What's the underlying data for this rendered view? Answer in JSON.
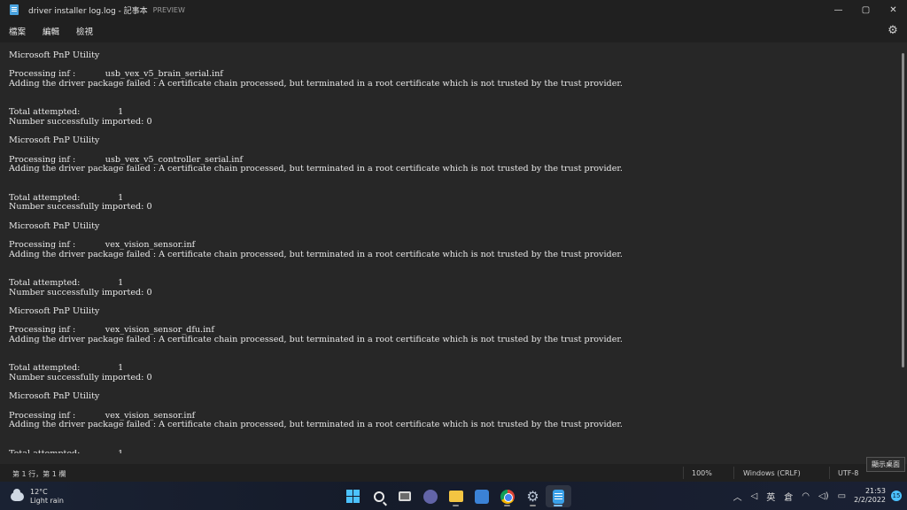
{
  "window": {
    "title": "driver installer log.log - 記事本",
    "preview_label": "PREVIEW",
    "controls": {
      "minimize": "—",
      "maximize": "▢",
      "close": "✕"
    }
  },
  "menu": {
    "file": "檔案",
    "edit": "編輯",
    "view": "檢視"
  },
  "document": {
    "content": "Microsoft PnP Utility\n\nProcessing inf :           usb_vex_v5_brain_serial.inf\nAdding the driver package failed : A certificate chain processed, but terminated in a root certificate which is not trusted by the trust provider.\n\n\nTotal attempted:              1\nNumber successfully imported: 0\n\nMicrosoft PnP Utility\n\nProcessing inf :           usb_vex_v5_controller_serial.inf\nAdding the driver package failed : A certificate chain processed, but terminated in a root certificate which is not trusted by the trust provider.\n\n\nTotal attempted:              1\nNumber successfully imported: 0\n\nMicrosoft PnP Utility\n\nProcessing inf :           vex_vision_sensor.inf\nAdding the driver package failed : A certificate chain processed, but terminated in a root certificate which is not trusted by the trust provider.\n\n\nTotal attempted:              1\nNumber successfully imported: 0\n\nMicrosoft PnP Utility\n\nProcessing inf :           vex_vision_sensor_dfu.inf\nAdding the driver package failed : A certificate chain processed, but terminated in a root certificate which is not trusted by the trust provider.\n\n\nTotal attempted:              1\nNumber successfully imported: 0\n\nMicrosoft PnP Utility\n\nProcessing inf :           vex_vision_sensor.inf\nAdding the driver package failed : A certificate chain processed, but terminated in a root certificate which is not trusted by the trust provider.\n\n\nTotal attempted:              1"
  },
  "status": {
    "position": "第 1 行，第 1 欄",
    "zoom": "100%",
    "line_ending": "Windows (CRLF)",
    "encoding": "UTF-8",
    "tooltip": "顯示桌面"
  },
  "taskbar": {
    "weather_temp": "12°C",
    "weather_desc": "Light rain",
    "apps": [
      "start-icon",
      "search-icon",
      "task-view-icon",
      "teams-chat-icon",
      "file-explorer-icon",
      "microsoft-store-icon",
      "chrome-icon",
      "settings-icon",
      "notepad-icon"
    ],
    "tray": {
      "chevron": "︿",
      "pen": "◁",
      "ime": "英",
      "ime_mode": "倉",
      "wifi": "◠",
      "volume": "◁)",
      "battery": "▭"
    },
    "time": "21:53",
    "date": "2/2/2022",
    "notification_count": "15"
  },
  "colors": {
    "background": "#272727",
    "chrome": "#202020",
    "accent": "#4cc2ff"
  }
}
